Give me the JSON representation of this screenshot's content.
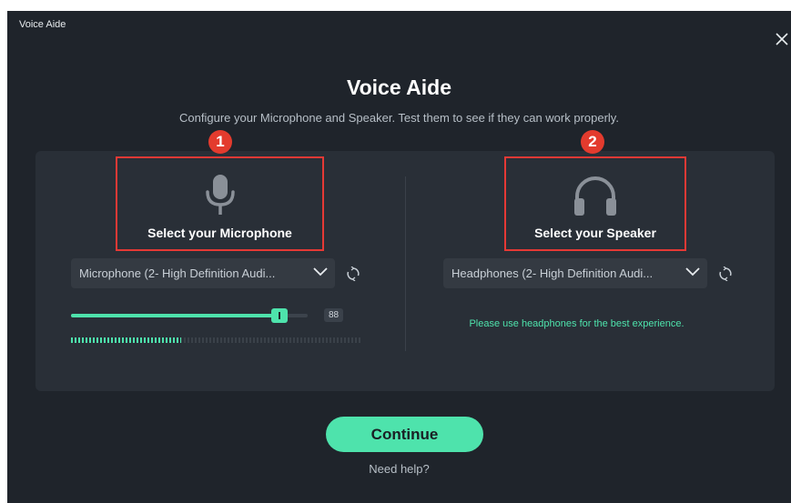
{
  "window": {
    "title": "Voice Aide"
  },
  "dialog": {
    "heading": "Voice Aide",
    "subtitle": "Configure your Microphone and Speaker. Test them to see if they can work properly."
  },
  "microphone": {
    "step": "1",
    "label": "Select your Microphone",
    "icon": "microphone-icon",
    "selected": "Microphone (2- High Definition Audi...",
    "volume_value": "88",
    "volume_level": 0.88,
    "input_level": 0.38
  },
  "speaker": {
    "step": "2",
    "label": "Select your Speaker",
    "icon": "headphones-icon",
    "selected": "Headphones (2- High Definition Audi...",
    "hint": "Please use headphones for the best experience."
  },
  "footer": {
    "continue_label": "Continue",
    "help_label": "Need help?"
  },
  "colors": {
    "background": "#1f242b",
    "panel": "#292f37",
    "accent": "#4ee3ac",
    "highlight": "#e53935",
    "badge": "#e33b2e"
  }
}
